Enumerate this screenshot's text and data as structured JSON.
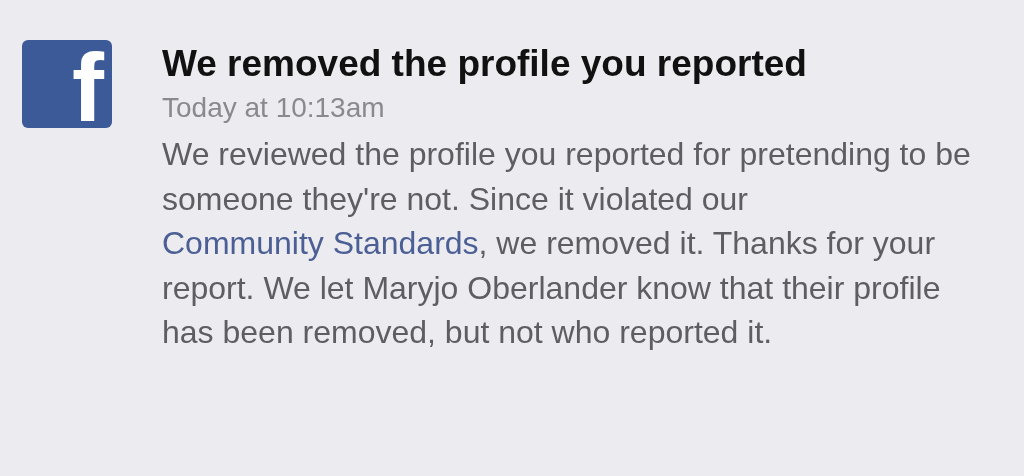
{
  "notification": {
    "logo": "f",
    "title": "We removed the profile you reported",
    "time": "Today at 10:13am",
    "body": {
      "before": "We reviewed the profile you reported for pretending to be someone they're not. Since it violated our ",
      "link": "Community Standards",
      "after": ", we removed it. Thanks for your report. We let Maryjo Oberlander know that their profile has been removed, but not who reported it."
    }
  }
}
